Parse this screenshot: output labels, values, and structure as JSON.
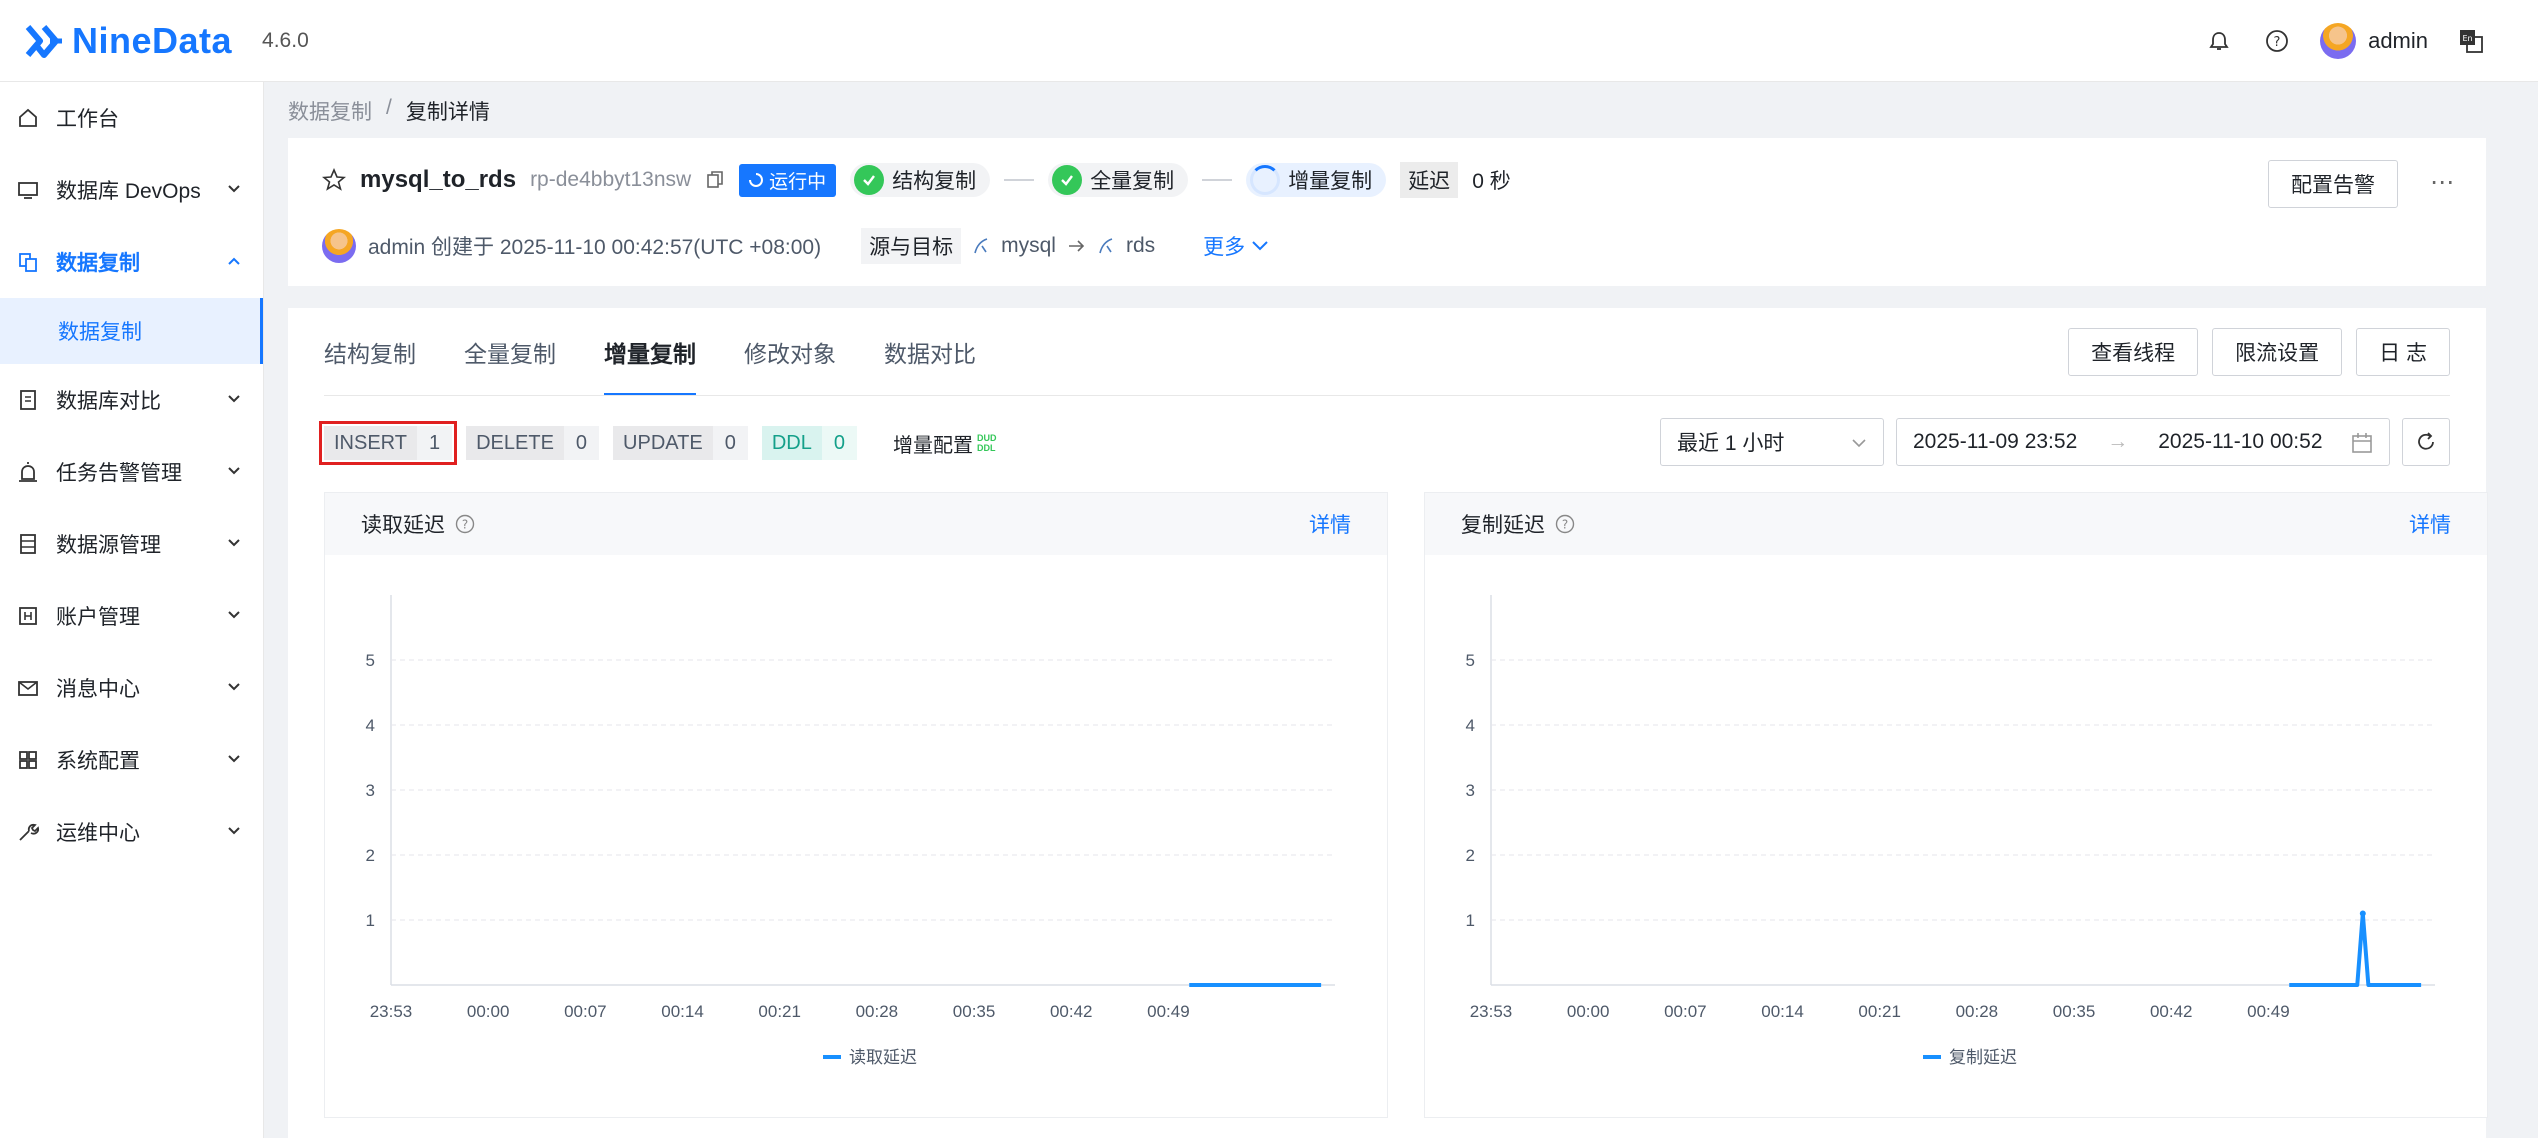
{
  "header": {
    "brand": "NineData",
    "version": "4.6.0",
    "user": "admin",
    "icons": [
      "bell-icon",
      "help-icon",
      "avatar",
      "language-icon"
    ]
  },
  "sidebar": {
    "items": [
      {
        "label": "工作台",
        "icon": "home-icon"
      },
      {
        "label": "数据库 DevOps",
        "icon": "monitor-icon"
      },
      {
        "label": "数据复制",
        "icon": "copy-icon",
        "active": true
      },
      {
        "label": "数据库对比",
        "icon": "compare-icon"
      },
      {
        "label": "任务告警管理",
        "icon": "alarm-icon"
      },
      {
        "label": "数据源管理",
        "icon": "datasource-icon"
      },
      {
        "label": "账户管理",
        "icon": "account-icon"
      },
      {
        "label": "消息中心",
        "icon": "mail-icon"
      },
      {
        "label": "系统配置",
        "icon": "grid-icon"
      },
      {
        "label": "运维中心",
        "icon": "wrench-icon"
      }
    ],
    "sub_item": "数据复制"
  },
  "breadcrumb": {
    "parent": "数据复制",
    "sep": "/",
    "current": "复制详情"
  },
  "summary": {
    "name": "mysql_to_rds",
    "id": "rp-de4bbyt13nsw",
    "status": "运行中",
    "steps": [
      "结构复制",
      "全量复制",
      "增量复制"
    ],
    "delay_label": "延迟",
    "delay_value": "0 秒",
    "creator": "admin 创建于 2025-11-10 00:42:57(UTC +08:00)",
    "src_target_label": "源与目标",
    "source": "mysql",
    "target": "rds",
    "more": "更多",
    "alert_button": "配置告警"
  },
  "tabs": {
    "items": [
      "结构复制",
      "全量复制",
      "增量复制",
      "修改对象",
      "数据对比"
    ],
    "active": "增量复制",
    "actions": [
      "查看线程",
      "限流设置",
      "日 志"
    ]
  },
  "counters": [
    {
      "key": "INSERT",
      "value": "1"
    },
    {
      "key": "DELETE",
      "value": "0"
    },
    {
      "key": "UPDATE",
      "value": "0"
    },
    {
      "key": "DDL",
      "value": "0"
    }
  ],
  "incr_config": {
    "label": "增量配置",
    "tag_top": "DUD",
    "tag_bottom": "DDL"
  },
  "filters": {
    "range_select": "最近 1 小时",
    "start": "2025-11-09 23:52",
    "arrow": "→",
    "end": "2025-11-10 00:52"
  },
  "colors": {
    "accent": "#1677ff",
    "success": "#34c759",
    "highlight": "#e02020"
  },
  "chart_data": [
    {
      "type": "line",
      "title": "读取延迟",
      "detail_link": "详情",
      "x_ticks": [
        "23:53",
        "00:00",
        "00:07",
        "00:14",
        "00:21",
        "00:28",
        "00:35",
        "00:42",
        "00:49"
      ],
      "y_ticks": [
        1,
        2,
        3,
        4,
        5
      ],
      "ylim": [
        0,
        6
      ],
      "xlim": [
        0,
        68
      ],
      "series": [
        {
          "name": "读取延迟",
          "x": [
            57.5,
            58,
            59,
            60,
            61,
            62,
            63,
            64,
            65,
            66,
            67
          ],
          "y": [
            0,
            0,
            0,
            0,
            0,
            0,
            0,
            0,
            0,
            0,
            0
          ]
        }
      ],
      "grid": true,
      "legend": "bottom"
    },
    {
      "type": "line",
      "title": "复制延迟",
      "detail_link": "详情",
      "x_ticks": [
        "23:53",
        "00:00",
        "00:07",
        "00:14",
        "00:21",
        "00:28",
        "00:35",
        "00:42",
        "00:49"
      ],
      "y_ticks": [
        1,
        2,
        3,
        4,
        5
      ],
      "ylim": [
        0,
        6
      ],
      "xlim": [
        0,
        68
      ],
      "series": [
        {
          "name": "复制延迟",
          "x": [
            57.5,
            59,
            61,
            62.4,
            62.8,
            63.2,
            63.6,
            65,
            67
          ],
          "y": [
            0,
            0,
            0,
            0,
            1.1,
            0,
            0,
            0,
            0
          ]
        }
      ],
      "grid": true,
      "legend": "bottom"
    }
  ]
}
